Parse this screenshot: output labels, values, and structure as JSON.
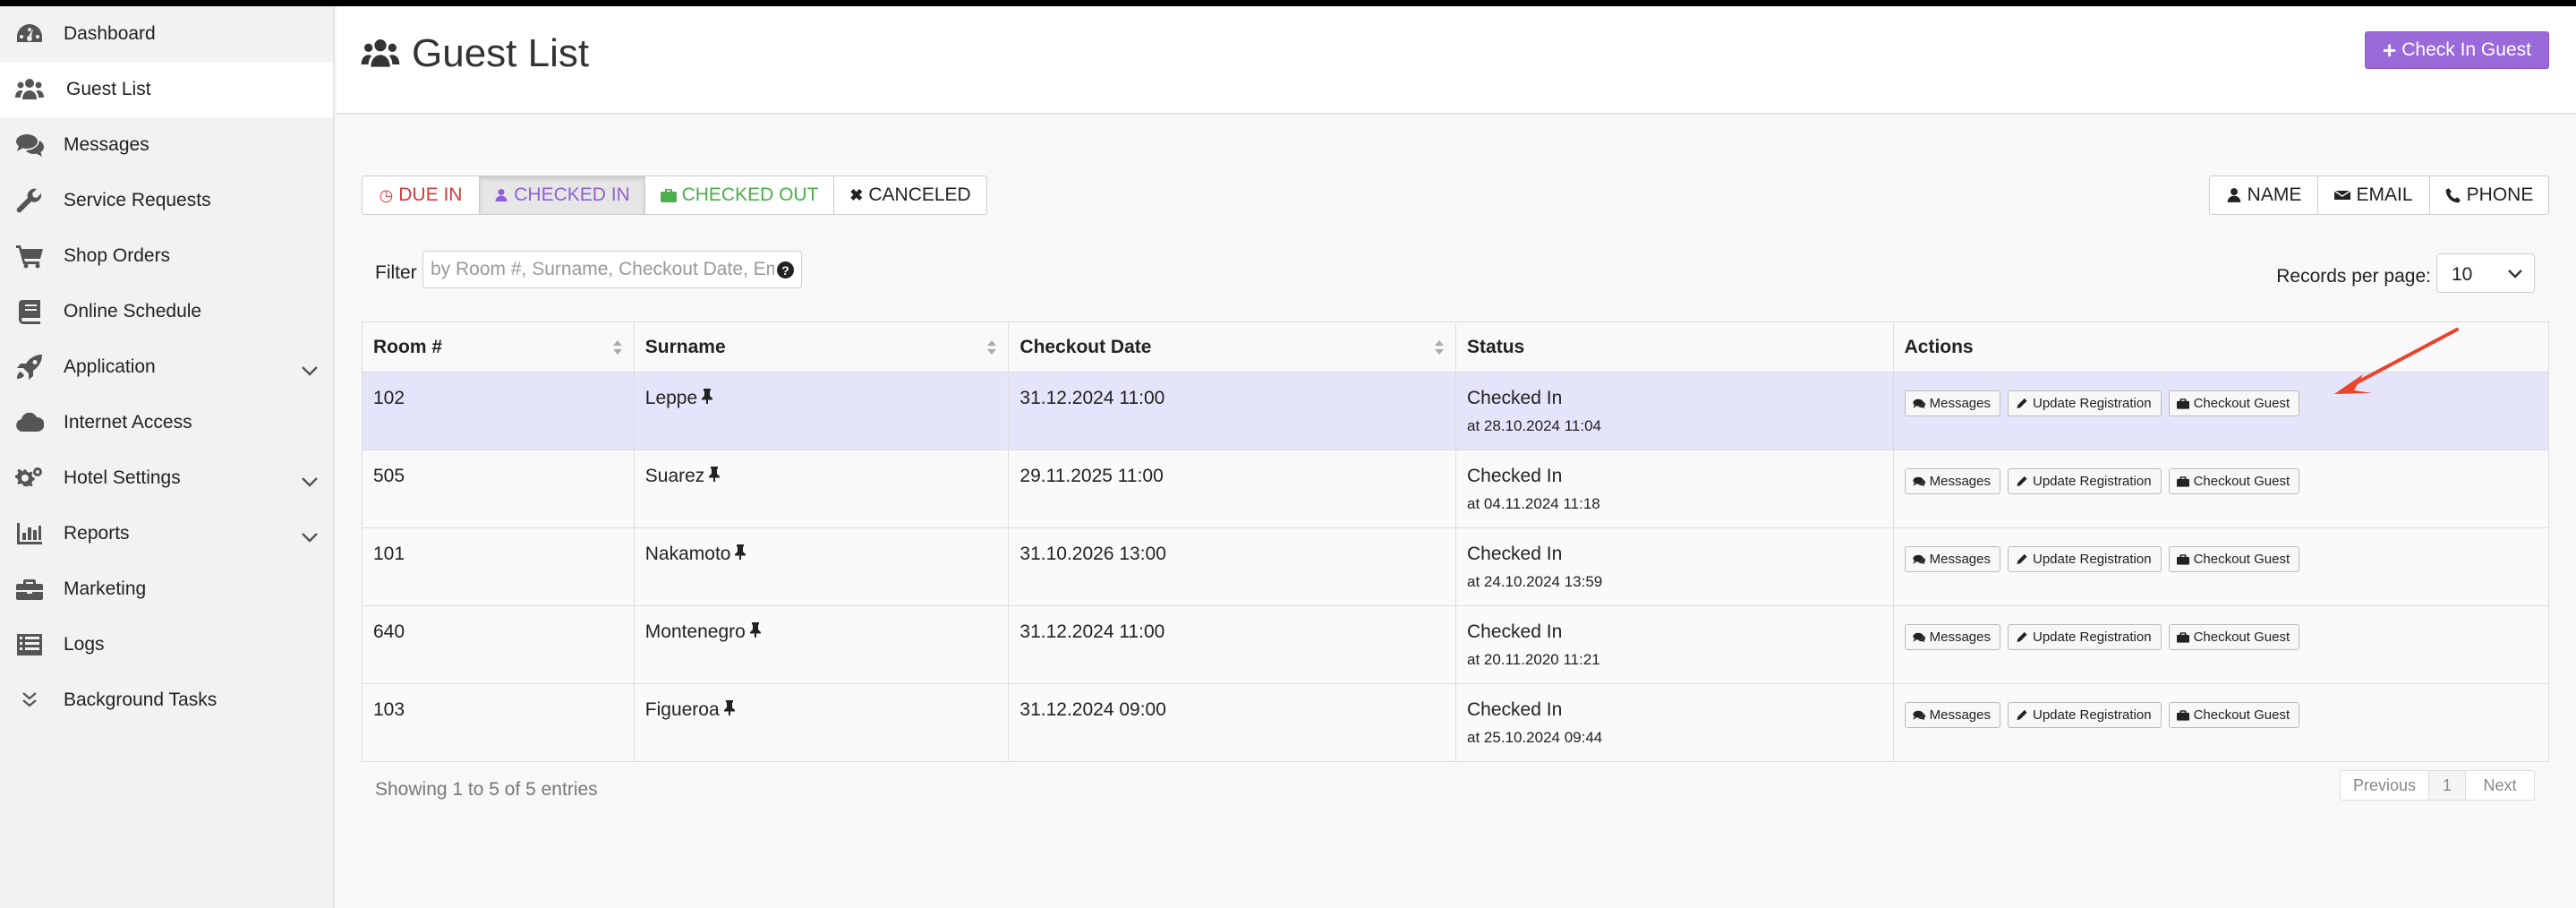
{
  "sidebar": {
    "items": [
      {
        "label": "Dashboard",
        "icon": "dashboard-icon"
      },
      {
        "label": "Guest List",
        "icon": "users-icon",
        "active": true
      },
      {
        "label": "Messages",
        "icon": "comments-icon"
      },
      {
        "label": "Service Requests",
        "icon": "wrench-icon"
      },
      {
        "label": "Shop Orders",
        "icon": "cart-icon"
      },
      {
        "label": "Online Schedule",
        "icon": "book-icon"
      },
      {
        "label": "Application",
        "icon": "rocket-icon",
        "expandable": true
      },
      {
        "label": "Internet Access",
        "icon": "cloud-icon"
      },
      {
        "label": "Hotel Settings",
        "icon": "cogs-icon",
        "expandable": true
      },
      {
        "label": "Reports",
        "icon": "bar-chart-icon",
        "expandable": true
      },
      {
        "label": "Marketing",
        "icon": "briefcase-icon"
      },
      {
        "label": "Logs",
        "icon": "list-icon"
      },
      {
        "label": "Background Tasks",
        "icon": "double-chevron-down-icon"
      }
    ]
  },
  "header": {
    "title": "Guest List",
    "checkin_label": "Check In Guest"
  },
  "tabs": {
    "due_in": "DUE IN",
    "checked_in": "CHECKED IN",
    "checked_out": "CHECKED OUT",
    "canceled": "CANCELED"
  },
  "sort_buttons": {
    "name": "NAME",
    "email": "EMAIL",
    "phone": "PHONE"
  },
  "filter": {
    "label": "Filter",
    "placeholder": "by Room #, Surname, Checkout Date, Email"
  },
  "records_per_page": {
    "label": "Records per page:",
    "value": "10"
  },
  "table": {
    "columns": [
      "Room #",
      "Surname",
      "Checkout Date",
      "Status",
      "Actions"
    ],
    "rows": [
      {
        "room": "102",
        "surname": "Leppe",
        "checkout": "31.12.2024 11:00",
        "status": "Checked In",
        "status_time": "at 28.10.2024 11:04"
      },
      {
        "room": "505",
        "surname": "Suarez",
        "checkout": "29.11.2025 11:00",
        "status": "Checked In",
        "status_time": "at 04.11.2024 11:18"
      },
      {
        "room": "101",
        "surname": "Nakamoto",
        "checkout": "31.10.2026 13:00",
        "status": "Checked In",
        "status_time": "at 24.10.2024 13:59"
      },
      {
        "room": "640",
        "surname": "Montenegro",
        "checkout": "31.12.2024 11:00",
        "status": "Checked In",
        "status_time": "at 20.11.2020 11:21"
      },
      {
        "room": "103",
        "surname": "Figueroa",
        "checkout": "31.12.2024 09:00",
        "status": "Checked In",
        "status_time": "at 25.10.2024 09:44"
      }
    ],
    "actions": {
      "messages": "Messages",
      "update": "Update Registration",
      "checkout": "Checkout Guest"
    }
  },
  "footer": {
    "showing": "Showing 1 to 5 of 5 entries",
    "previous": "Previous",
    "page": "1",
    "next": "Next"
  },
  "colors": {
    "accent": "#9b6ad9",
    "due_in": "#d63a3a",
    "checked_out": "#4cae4c",
    "highlight_row": "#e4e4fa",
    "annotation_arrow": "#e8452c"
  }
}
